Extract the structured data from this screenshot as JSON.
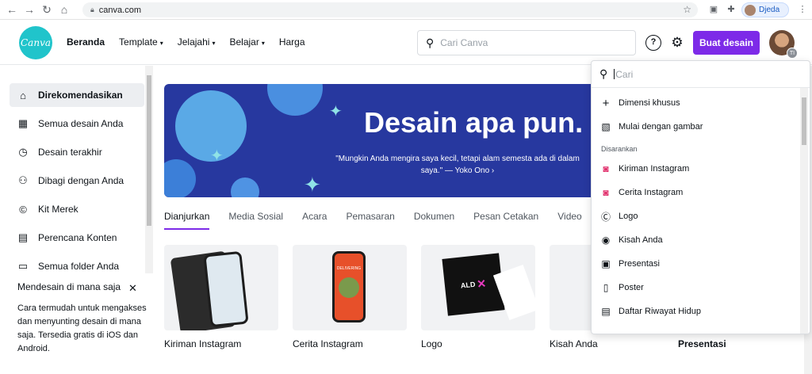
{
  "browser": {
    "url": "canva.com",
    "profile_name": "Djeda"
  },
  "header": {
    "logo_text": "Canva",
    "nav": [
      "Beranda",
      "Template",
      "Jelajahi",
      "Belajar",
      "Harga"
    ],
    "search_placeholder": "Cari Canva",
    "help_icon": "?",
    "create_label": "Buat desain",
    "avatar_badge": "TI"
  },
  "sidebar": {
    "items": [
      {
        "label": "Direkomendasikan",
        "icon": "home-icon",
        "glyph": "⌂"
      },
      {
        "label": "Semua desain Anda",
        "icon": "grid-icon",
        "glyph": "▦"
      },
      {
        "label": "Desain terakhir",
        "icon": "clock-icon",
        "glyph": "◷"
      },
      {
        "label": "Dibagi dengan Anda",
        "icon": "share-users-icon",
        "glyph": "⚇"
      },
      {
        "label": "Kit Merek",
        "icon": "brand-kit-icon",
        "glyph": "©"
      },
      {
        "label": "Perencana Konten",
        "icon": "calendar-icon",
        "glyph": "▤"
      },
      {
        "label": "Semua folder Anda",
        "icon": "folder-icon",
        "glyph": "▭"
      }
    ],
    "promo": {
      "title": "Mendesain di mana saja",
      "close": "✕",
      "text": "Cara termudah untuk mengakses dan menyunting desain di mana saja. Tersedia gratis di iOS dan Android."
    }
  },
  "banner": {
    "title": "Desain apa pun.",
    "quote_line1": "\"Mungkin Anda mengira saya kecil, tetapi alam semesta ada di dalam",
    "quote_line2": "saya.\" — Yoko Ono ›"
  },
  "tabs": [
    "Dianjurkan",
    "Media Sosial",
    "Acara",
    "Pemasaran",
    "Dokumen",
    "Pesan Cetakan",
    "Video",
    "S"
  ],
  "cards": [
    {
      "label": "Kiriman Instagram"
    },
    {
      "label": "Cerita Instagram",
      "thumb_text": "DELIVERING"
    },
    {
      "label": "Logo",
      "thumb_text": "ALD"
    },
    {
      "label": "Kisah Anda"
    },
    {
      "label": "Presentasi"
    }
  ],
  "dropdown": {
    "search_placeholder": "Cari",
    "custom_size": "Dimensi khusus",
    "start_with_image": "Mulai dengan gambar",
    "section_label": "Disarankan",
    "suggestions": [
      {
        "label": "Kiriman Instagram",
        "icon": "instagram-icon",
        "glyph": "◙"
      },
      {
        "label": "Cerita Instagram",
        "icon": "instagram-icon",
        "glyph": "◙"
      },
      {
        "label": "Logo",
        "icon": "logo-icon",
        "glyph": "Ⓒ"
      },
      {
        "label": "Kisah Anda",
        "icon": "camera-icon",
        "glyph": "◉"
      },
      {
        "label": "Presentasi",
        "icon": "presentation-icon",
        "glyph": "▣"
      },
      {
        "label": "Poster",
        "icon": "poster-icon",
        "glyph": "▯"
      },
      {
        "label": "Daftar Riwayat Hidup",
        "icon": "document-icon",
        "glyph": "▤"
      }
    ]
  },
  "colors": {
    "brand_teal": "#20c4cb",
    "accent_purple": "#7d2ae8",
    "banner_blue": "#27389f"
  }
}
